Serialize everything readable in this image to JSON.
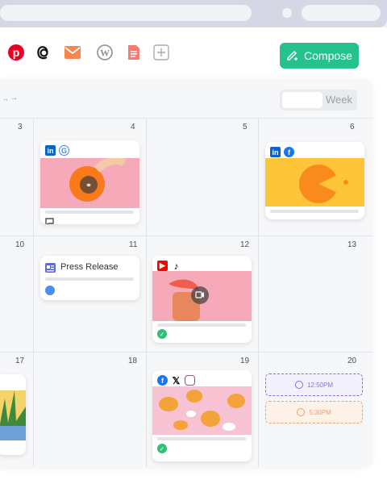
{
  "toolbar": {
    "icons": [
      "pinterest-icon",
      "threads-icon",
      "email-icon",
      "wordpress-icon",
      "document-icon",
      "add-icon"
    ],
    "compose_label": "Compose"
  },
  "calendar": {
    "view_label": "Week",
    "days": [
      "3",
      "4",
      "5",
      "6",
      "10",
      "11",
      "12",
      "13",
      "17",
      "18",
      "19",
      "20"
    ],
    "press_release_label": "Press Release",
    "time_slots": [
      "12:50PM",
      "5:30PM"
    ]
  },
  "colors": {
    "accent": "#23c28f",
    "pink": "#f6a9b8",
    "yellow": "#fdc537",
    "purple": "#7f74e0",
    "orange": "#f2a06b"
  }
}
